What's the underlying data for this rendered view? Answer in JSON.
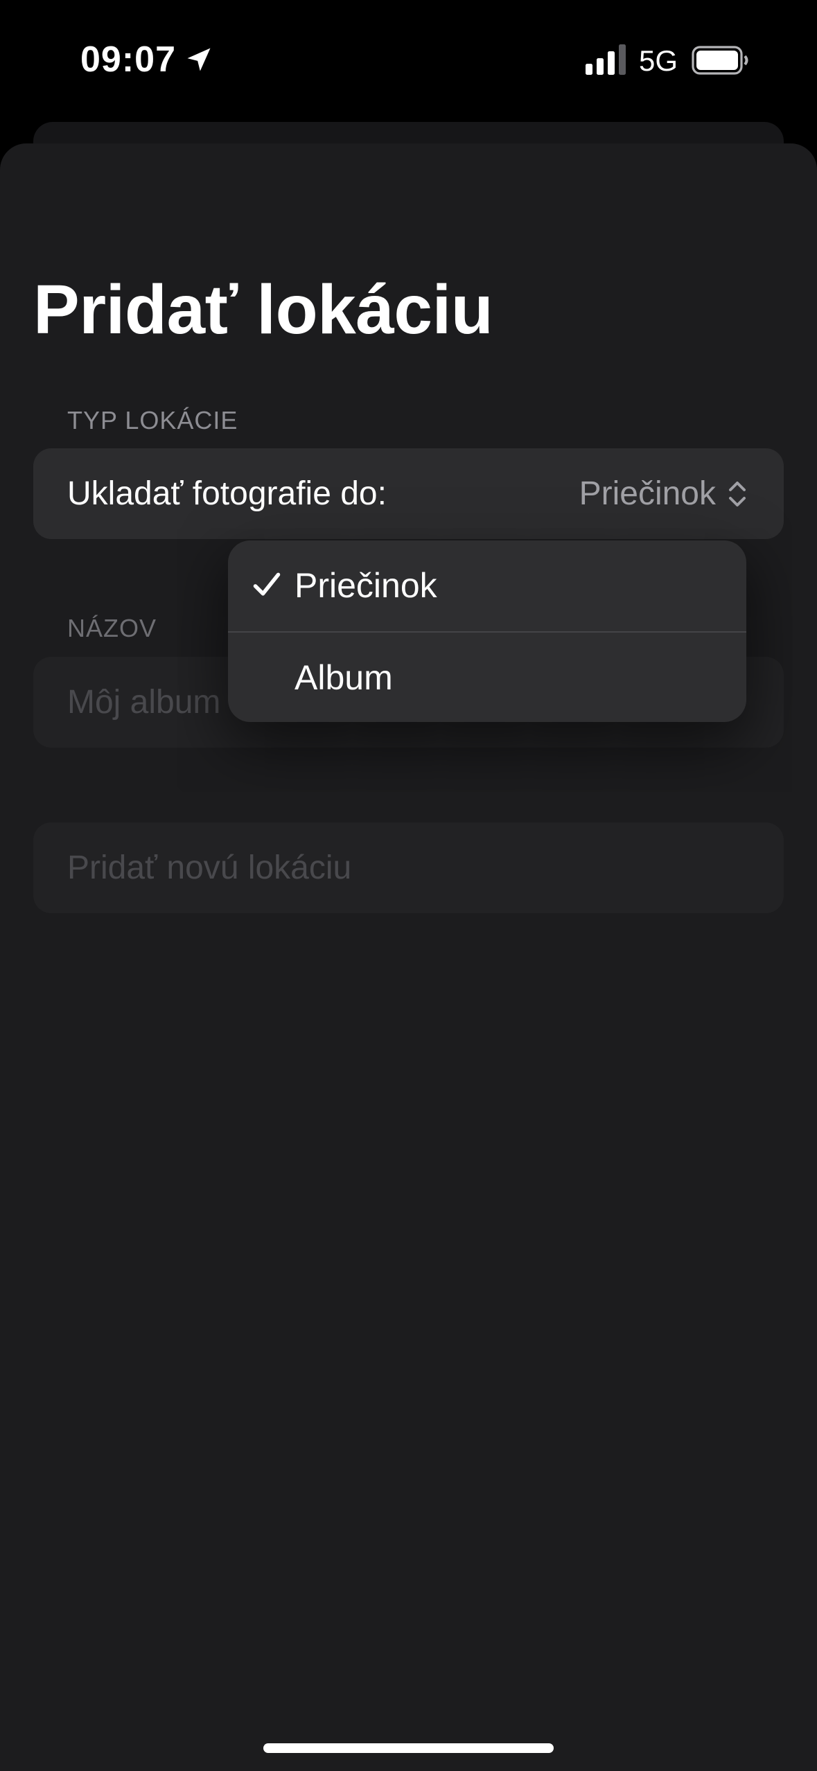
{
  "status_bar": {
    "time": "09:07",
    "network": "5G",
    "signal_bars": 3,
    "battery_level": 1.0
  },
  "page": {
    "title": "Pridať lokáciu"
  },
  "type_section": {
    "label": "TYP LOKÁCIE",
    "row_label": "Ukladať fotografie do:",
    "selected_value": "Priečinok"
  },
  "name_section": {
    "label": "NÁZOV",
    "placeholder": "Môj album"
  },
  "add_button": {
    "label": "Pridať novú lokáciu",
    "enabled": false
  },
  "dropdown": {
    "options": [
      {
        "label": "Priečinok",
        "selected": true
      },
      {
        "label": "Album",
        "selected": false
      }
    ]
  },
  "icons": {
    "location": "location-arrow-icon",
    "signal": "cellular-signal-icon",
    "battery": "battery-icon",
    "chevrons": "chevron-up-down-icon",
    "check": "checkmark-icon"
  },
  "colors": {
    "background": "#000000",
    "sheet": "#1c1c1e",
    "row": "#2c2c2e",
    "menu": "#2e2e30",
    "secondary_text": "#8d8d93",
    "placeholder_text": "#5e5e63"
  }
}
